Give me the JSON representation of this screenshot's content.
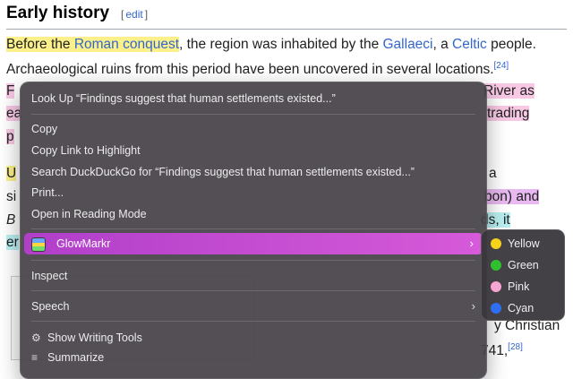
{
  "article": {
    "heading": "Early history",
    "edit_open": "[",
    "edit_label": "edit",
    "edit_close": "]",
    "line1": {
      "p1": "Before the ",
      "link1": "Roman conquest",
      "p2": ", the region was inhabited by the ",
      "link2": "Gallaeci",
      "p3": ", a ",
      "link3": "Celtic",
      "p4": " people."
    },
    "line2": {
      "text": "Archaeological ruins from this period have been uncovered in several locations.",
      "ref": "[24]"
    },
    "peek": {
      "l3a": "F",
      "l3b": "River as",
      "l4a": "ea",
      "l4b": "trading",
      "l5a": "p",
      "l6a": "U",
      "l6b": "a",
      "l7a": "si",
      "l7b": "bon) and",
      "l8a": "B",
      "l8b": "ds, it",
      "l9a": "er",
      "l11b": "y Christian",
      "l12b": "741,",
      "ref28": "[28]"
    }
  },
  "context_menu": {
    "items": [
      "Look Up “Findings suggest that human settlements existed...”",
      "Copy",
      "Copy Link to Highlight",
      "Search DuckDuckGo for “Findings suggest that human settlements existed...”",
      "Print...",
      "Open in Reading Mode",
      "GlowMarkr",
      "Inspect",
      "Speech",
      "Show Writing Tools",
      "Summarize"
    ],
    "chevron": "›"
  },
  "submenu": {
    "items": [
      {
        "label": "Yellow",
        "color": "#f5d31a"
      },
      {
        "label": "Green",
        "color": "#2fbf2f"
      },
      {
        "label": "Pink",
        "color": "#f7a6d4"
      },
      {
        "label": "Cyan",
        "color": "#2f6ef0"
      }
    ]
  },
  "colors": {
    "highlight_yellow": "#fbf08a",
    "highlight_pink": "#f8c8e4",
    "highlight_cyan": "#b9eff0",
    "menu_active": "#c04ad0"
  }
}
